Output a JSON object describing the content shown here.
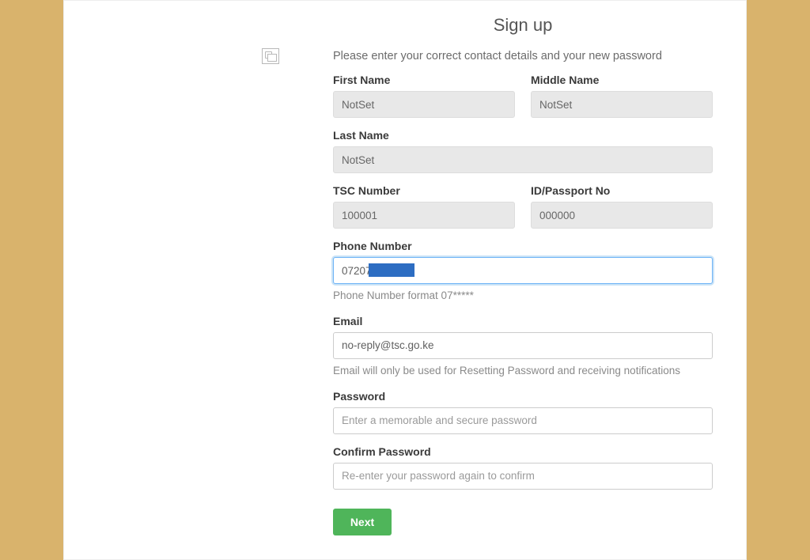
{
  "title": "Sign up",
  "intro": "Please enter your correct contact details and your new password",
  "fields": {
    "first_name": {
      "label": "First Name",
      "value": "NotSet"
    },
    "middle_name": {
      "label": "Middle Name",
      "value": "NotSet"
    },
    "last_name": {
      "label": "Last Name",
      "value": "NotSet"
    },
    "tsc_number": {
      "label": "TSC Number",
      "value": "100001"
    },
    "id_passport": {
      "label": "ID/Passport No",
      "value": "000000"
    },
    "phone": {
      "label": "Phone Number",
      "value": "07207",
      "hint": "Phone Number format 07*****"
    },
    "email": {
      "label": "Email",
      "value": "no-reply@tsc.go.ke",
      "hint": "Email will only be used for Resetting Password and receiving notifications"
    },
    "password": {
      "label": "Password",
      "placeholder": "Enter a memorable and secure password"
    },
    "confirm_password": {
      "label": "Confirm Password",
      "placeholder": "Re-enter your password again to confirm"
    }
  },
  "buttons": {
    "next": "Next"
  }
}
